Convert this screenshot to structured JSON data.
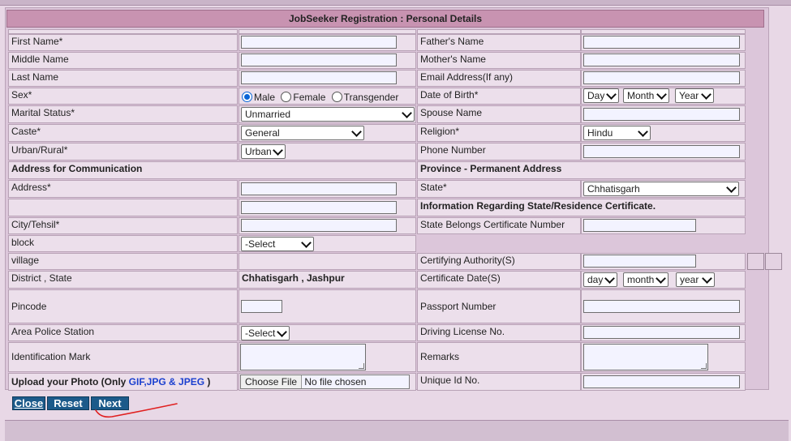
{
  "header": {
    "title": "JobSeeker Registration : Personal Details"
  },
  "labels": {
    "first_name": "First Name*",
    "fathers_name": "Father's Name",
    "middle_name": "Middle Name",
    "mothers_name": "Mother's Name",
    "last_name": "Last Name",
    "email": "Email Address(If any)",
    "sex": "Sex*",
    "dob": "Date of Birth*",
    "marital": "Marital Status*",
    "spouse": "Spouse Name",
    "caste": "Caste*",
    "religion": "Religion*",
    "urban_rural": "Urban/Rural*",
    "phone": "Phone Number",
    "addr_comm": "Address for Communication",
    "province": "Province - Permanent Address",
    "address": "Address*",
    "state": "State*",
    "info_state": "Information Regarding State/Residence Certificate.",
    "city": "City/Tehsil*",
    "state_cert": "State Belongs Certificate Number",
    "block": "block",
    "village": "village",
    "cert_auth": "Certifying Authority(S)",
    "district_state": "District , State",
    "cert_date": "Certificate Date(S)",
    "pincode": "Pincode",
    "passport": "Passport Number",
    "police": "Area Police Station",
    "driving": "Driving License No.",
    "ident": "Identification Mark",
    "remarks": "Remarks",
    "upload_pre": "Upload your Photo (Only ",
    "upload_types": "GIF,JPG & JPEG",
    "upload_post": " )",
    "unique_id": "Unique Id No."
  },
  "values": {
    "district_state": "Chhatisgarh , Jashpur"
  },
  "sex_options": {
    "male": "Male",
    "female": "Female",
    "transgender": "Transgender",
    "selected": "Male"
  },
  "selects": {
    "dob_day": "Day",
    "dob_month": "Month",
    "dob_year": "Year",
    "marital": "Unmarried",
    "caste": "General",
    "religion": "Hindu",
    "urban_rural": "Urban",
    "state": "Chhatisgarh",
    "block": "-Select",
    "cert_day": "day",
    "cert_month": "month",
    "cert_year": "year",
    "police": "-Select"
  },
  "file": {
    "button": "Choose File",
    "status": "No file chosen"
  },
  "buttons": {
    "close": "Close",
    "reset": "Reset",
    "next": "Next"
  },
  "colors": {
    "header_bg": "#c893b1",
    "button_bg": "#1c5a8a",
    "annotation": "#e02020"
  }
}
